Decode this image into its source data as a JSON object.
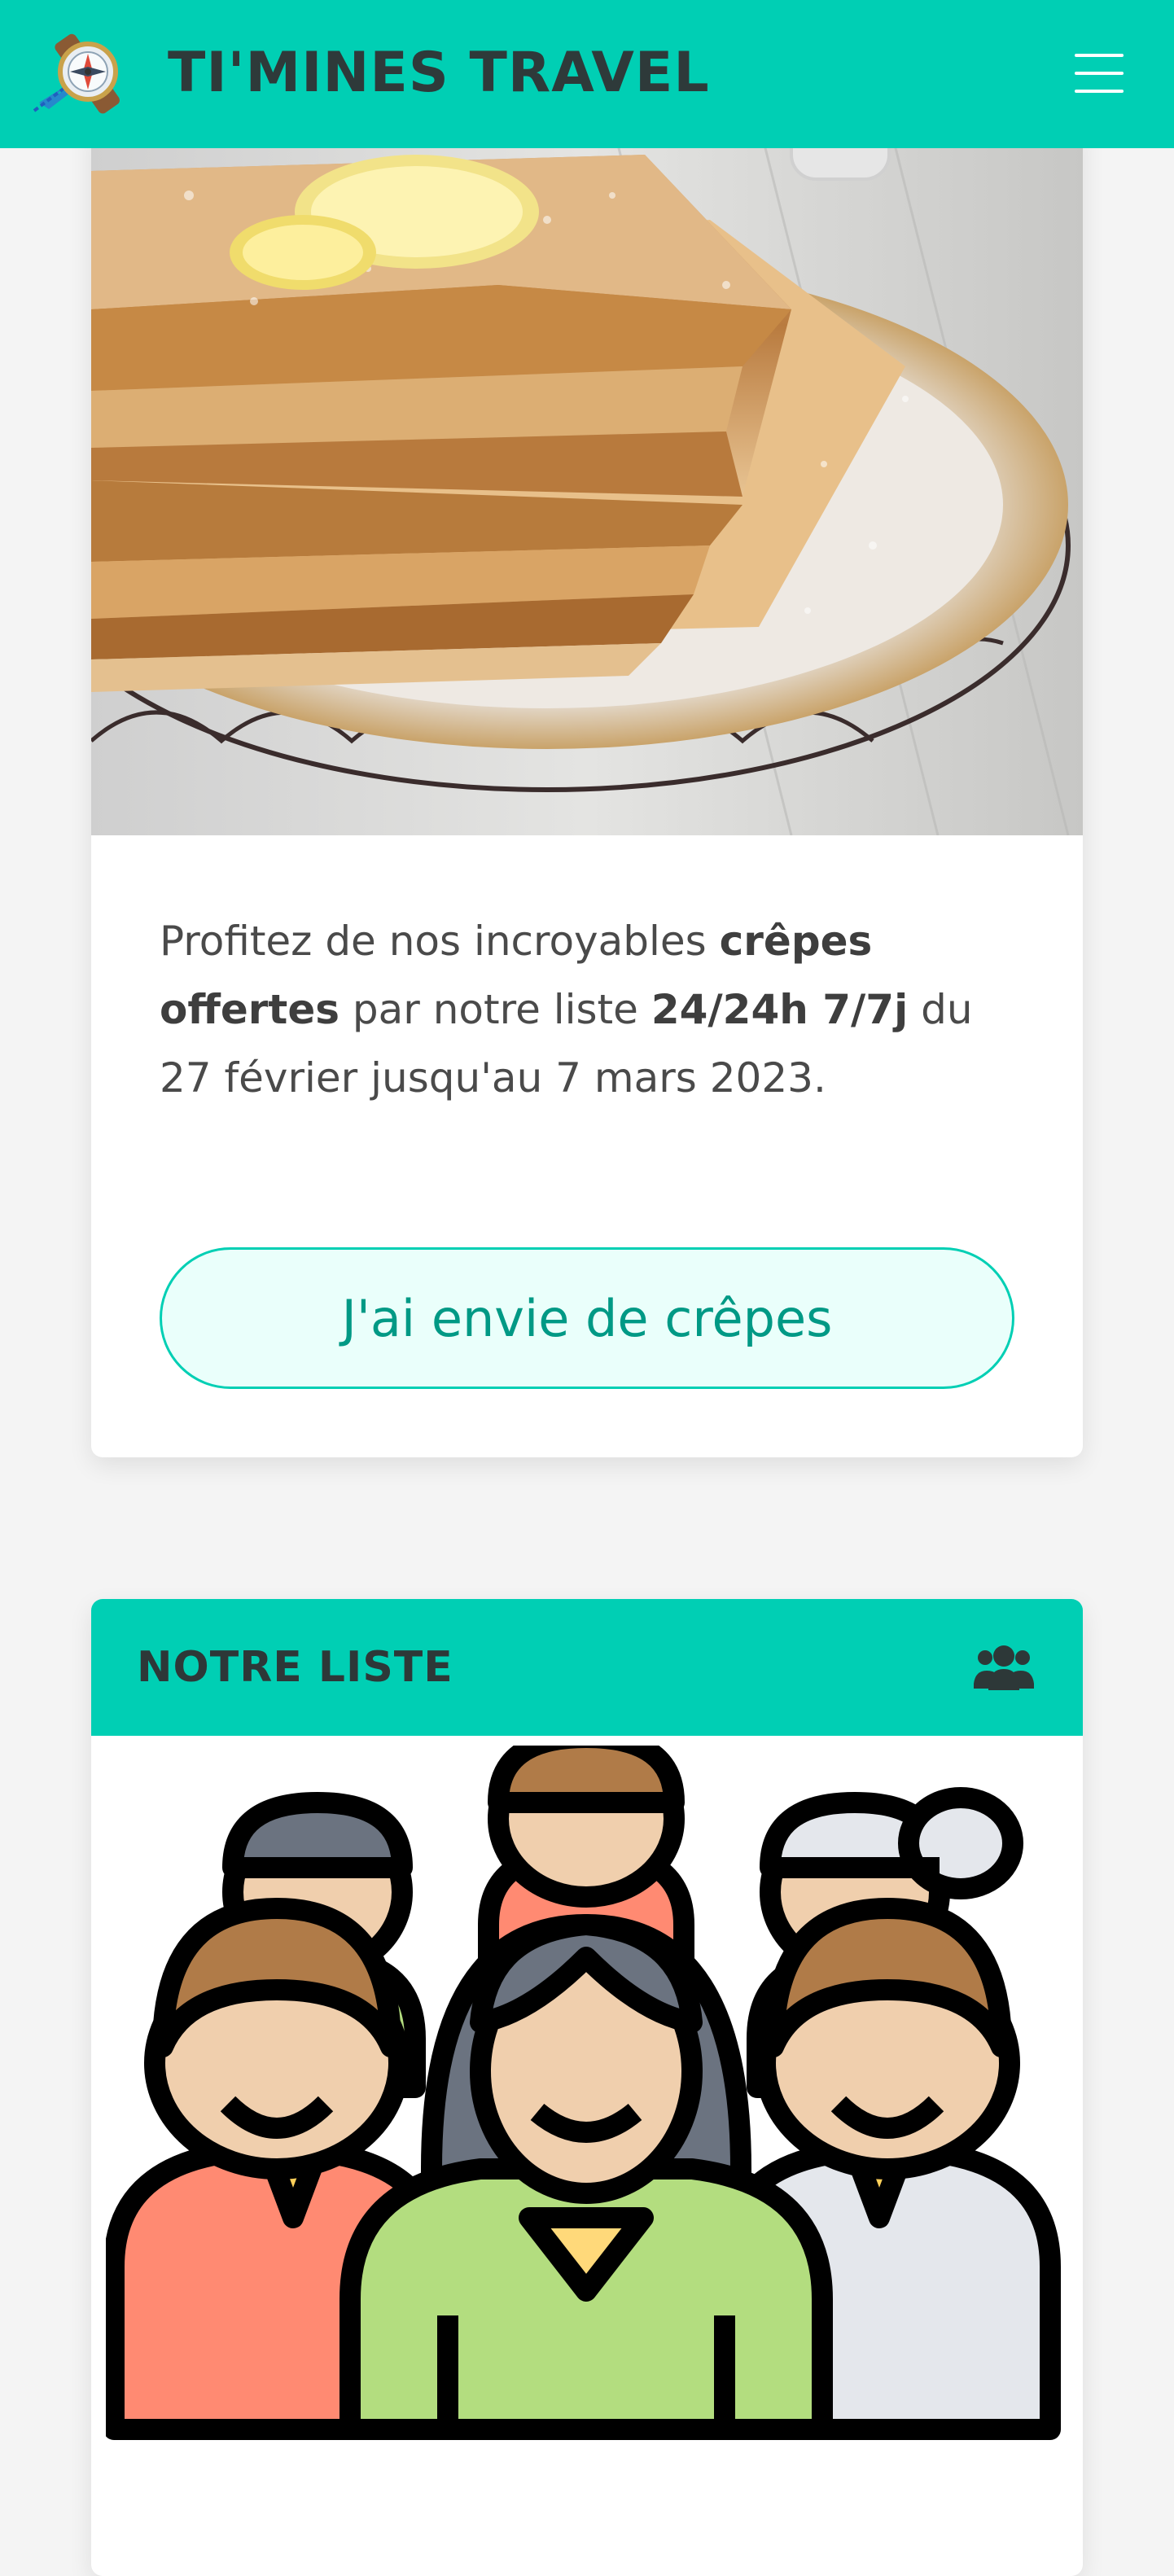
{
  "header": {
    "brand": "TI'MINES TRAVEL",
    "logo_icon": "compass-logo-icon",
    "menu_icon": "hamburger-menu-icon"
  },
  "promo": {
    "image": "crepes-photo",
    "text_parts": [
      {
        "t": "Profitez de nos incroyables ",
        "bold": false
      },
      {
        "t": "crêpes offertes",
        "bold": true
      },
      {
        "t": " par notre liste ",
        "bold": false
      },
      {
        "t": "24/24h 7/7j",
        "bold": true
      },
      {
        "t": " du 27 février jusqu'au 7 mars 2023.",
        "bold": false
      }
    ],
    "cta_label": "J'ai envie de crêpes"
  },
  "team": {
    "title": "NOTRE LISTE",
    "title_icon": "users-icon",
    "image": "group-of-people-illustration"
  },
  "colors": {
    "accent": "#00cfb4",
    "cta_text": "#009985",
    "cta_bg": "#eafffb",
    "page_bg": "#f4f4f4"
  }
}
